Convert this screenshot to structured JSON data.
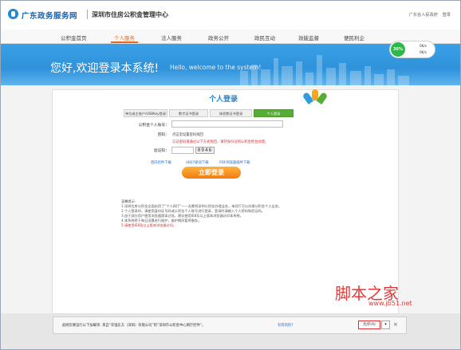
{
  "header": {
    "gov_name": "广东政务服务网",
    "center_name": "深圳市住房公积金管理中心",
    "links": [
      "广东省人民政府",
      "登录"
    ]
  },
  "nav": {
    "items": [
      "公积金首页",
      "个人服务",
      "法人服务",
      "政务公开",
      "政民互动",
      "效能监督",
      "便民利企"
    ],
    "active_index": 1
  },
  "banner": {
    "welcome": "您好,欢迎登录本系统!",
    "welcome_en": "Hello, welcome to the system!"
  },
  "speed_widget": {
    "percent": "36%",
    "up": "0K/s",
    "down": "0K/s"
  },
  "login": {
    "title": "个人登录",
    "tabs": [
      "单位或主账户/USBKey登录",
      "数字证书登录",
      "体验数证书登录",
      "个人登录"
    ],
    "active_tab": 3,
    "account_label": "公积金个人账号：",
    "password_label": "密码：",
    "password_hint": "点这里设置密码找回",
    "password_warning": "忘记密码请通过以下方式找回，请持身份证到公积金柜台办理。",
    "captcha_label": "验证码：",
    "captcha_value": "0946",
    "download_links": [
      "密码控件下载",
      "UKEY驱动下载",
      "PDF阅读器插件下载"
    ],
    "login_button": "立即登录"
  },
  "notes": {
    "heading": "温馨提示：",
    "lines": [
      "1.深圳住房公积金全面启用了“个人网厅”——无需到深圳公积金办理业务，本网厅可以办理公积金个人业务。",
      "2.个人登录时，请使用身份证号码或公积金个人账号进行登录，登录时请输入个人密码和验证码。",
      "3.由于部分用户使用浏览器版本过低，建议使用IE8及以上版本浏览器访问本系统。",
      "4.本系统将于每日凌晨进行维护，维护期间暂停服务。"
    ],
    "red_line": "5.请使用IE8及以上版本浏览器访问。"
  },
  "watermark": {
    "text": "脚本之家",
    "site": "www.jb51.net"
  },
  "notification": {
    "text": "此网页要运行以下加载项: 来自“华强东方（深圳）有限公司”的“深圳市公积金中心网厅控件”。",
    "link": "有何风险?",
    "allow_label": "允许(A)"
  },
  "colors": {
    "brand_blue": "#1d5fa6",
    "nav_active": "#e66a1d",
    "banner": "#2f92da",
    "tab_active": "#56ad36",
    "login_button": "#f27b0f",
    "warning": "#d92b2b"
  }
}
